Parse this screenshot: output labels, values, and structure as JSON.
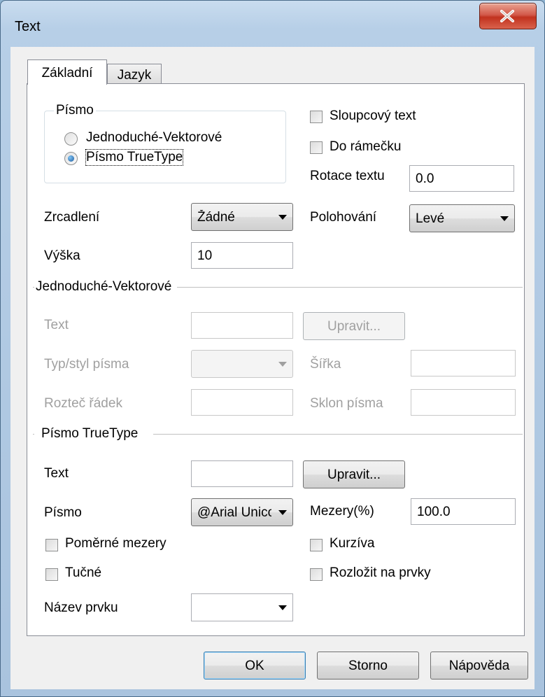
{
  "window": {
    "title": "Text"
  },
  "tabs": [
    {
      "label": "Základní",
      "active": true
    },
    {
      "label": "Jazyk",
      "active": false
    }
  ],
  "font_group": {
    "label": "Písmo",
    "radio_vector": "Jednoduché-Vektorové",
    "radio_truetype": "Písmo TrueType",
    "selected": "Písmo TrueType"
  },
  "checkboxes_top": {
    "column_text": "Sloupcový text",
    "in_frame": "Do rámečku"
  },
  "rotation": {
    "label": "Rotace textu",
    "value": "0.0"
  },
  "mirror": {
    "label": "Zrcadlení",
    "value": "Žádné"
  },
  "alignment": {
    "label": "Polohování",
    "value": "Levé"
  },
  "height": {
    "label": "Výška",
    "value": "10"
  },
  "vector_section": {
    "title": "Jednoduché-Vektorové",
    "text_label": "Text",
    "text_value": "",
    "edit_button": "Upravit...",
    "font_style_label": "Typ/styl písma",
    "width_label": "Šířka",
    "width_value": "",
    "line_spacing_label": "Rozteč řádek",
    "line_spacing_value": "",
    "slant_label": "Sklon písma",
    "slant_value": ""
  },
  "truetype_section": {
    "title": "Písmo TrueType",
    "text_label": "Text",
    "text_value": "",
    "edit_button": "Upravit...",
    "font_label": "Písmo",
    "font_value": "@Arial Unicode MS",
    "spacing_label": "Mezery(%)",
    "spacing_value": "100.0",
    "proportional": "Poměrné mezery",
    "italic": "Kurzíva",
    "bold": "Tučné",
    "explode": "Rozložit na prvky",
    "element_name_label": "Název prvku",
    "element_name_value": ""
  },
  "buttons": {
    "ok": "OK",
    "cancel": "Storno",
    "help": "Nápověda"
  },
  "colors": {
    "close_button": "#c1321f",
    "disabled_text": "#a0a0a0"
  }
}
